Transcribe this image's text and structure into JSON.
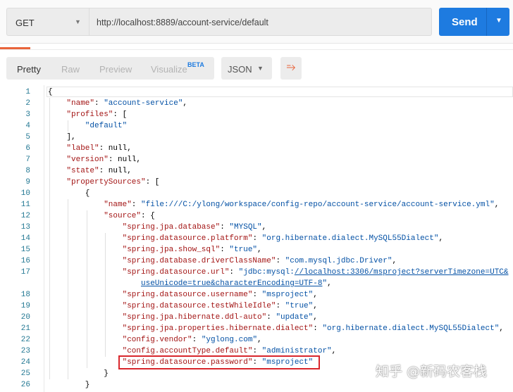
{
  "request": {
    "method": "GET",
    "url": "http://localhost:8889/account-service/default",
    "send_label": "Send"
  },
  "response_toolbar": {
    "views": [
      "Pretty",
      "Raw",
      "Preview",
      "Visualize"
    ],
    "beta_badge": "BETA",
    "format": "JSON",
    "wrap_icon": "wrap-lines-icon"
  },
  "colors": {
    "accent": "#1e7be0",
    "tab_indicator": "#e9643b",
    "key": "#a31515",
    "string": "#0451a5",
    "highlight_box": "#d9262c"
  },
  "code_lines": [
    {
      "n": "1",
      "i": 0,
      "t": [
        [
          "p",
          "{"
        ]
      ]
    },
    {
      "n": "2",
      "i": 1,
      "t": [
        [
          "k",
          "\"name\""
        ],
        [
          "p",
          ": "
        ],
        [
          "s",
          "\"account-service\""
        ],
        [
          "p",
          ","
        ]
      ]
    },
    {
      "n": "3",
      "i": 1,
      "t": [
        [
          "k",
          "\"profiles\""
        ],
        [
          "p",
          ": ["
        ]
      ]
    },
    {
      "n": "4",
      "i": 2,
      "t": [
        [
          "s",
          "\"default\""
        ]
      ]
    },
    {
      "n": "5",
      "i": 1,
      "t": [
        [
          "p",
          "],"
        ]
      ]
    },
    {
      "n": "6",
      "i": 1,
      "t": [
        [
          "k",
          "\"label\""
        ],
        [
          "p",
          ": null,"
        ]
      ]
    },
    {
      "n": "7",
      "i": 1,
      "t": [
        [
          "k",
          "\"version\""
        ],
        [
          "p",
          ": null,"
        ]
      ]
    },
    {
      "n": "8",
      "i": 1,
      "t": [
        [
          "k",
          "\"state\""
        ],
        [
          "p",
          ": null,"
        ]
      ]
    },
    {
      "n": "9",
      "i": 1,
      "t": [
        [
          "k",
          "\"propertySources\""
        ],
        [
          "p",
          ": ["
        ]
      ]
    },
    {
      "n": "10",
      "i": 2,
      "t": [
        [
          "p",
          "{"
        ]
      ]
    },
    {
      "n": "11",
      "i": 3,
      "t": [
        [
          "k",
          "\"name\""
        ],
        [
          "p",
          ": "
        ],
        [
          "s",
          "\"file:///C:/ylong/workspace/config-repo/account-service/account-service.yml\""
        ],
        [
          "p",
          ","
        ]
      ]
    },
    {
      "n": "12",
      "i": 3,
      "t": [
        [
          "k",
          "\"source\""
        ],
        [
          "p",
          ": {"
        ]
      ]
    },
    {
      "n": "13",
      "i": 4,
      "t": [
        [
          "k",
          "\"spring.jpa.database\""
        ],
        [
          "p",
          ": "
        ],
        [
          "s",
          "\"MYSQL\""
        ],
        [
          "p",
          ","
        ]
      ]
    },
    {
      "n": "14",
      "i": 4,
      "t": [
        [
          "k",
          "\"spring.datasource.platform\""
        ],
        [
          "p",
          ": "
        ],
        [
          "s",
          "\"org.hibernate.dialect.MySQL55Dialect\""
        ],
        [
          "p",
          ","
        ]
      ]
    },
    {
      "n": "15",
      "i": 4,
      "t": [
        [
          "k",
          "\"spring.jpa.show_sql\""
        ],
        [
          "p",
          ": "
        ],
        [
          "s",
          "\"true\""
        ],
        [
          "p",
          ","
        ]
      ]
    },
    {
      "n": "16",
      "i": 4,
      "t": [
        [
          "k",
          "\"spring.database.driverClassName\""
        ],
        [
          "p",
          ": "
        ],
        [
          "s",
          "\"com.mysql.jdbc.Driver\""
        ],
        [
          "p",
          ","
        ]
      ]
    },
    {
      "n": "17",
      "i": 4,
      "t": [
        [
          "k",
          "\"spring.datasource.url\""
        ],
        [
          "p",
          ": "
        ],
        [
          "s",
          "\"jdbc:mysql:"
        ],
        [
          "su",
          "//localhost:3306/msproject?serverTimezone=UTC&"
        ]
      ]
    },
    {
      "n": "",
      "i": 5,
      "t": [
        [
          "su",
          "useUnicode=true&characterEncoding=UTF-8"
        ],
        [
          "s",
          "\""
        ],
        [
          "p",
          ","
        ]
      ]
    },
    {
      "n": "18",
      "i": 4,
      "t": [
        [
          "k",
          "\"spring.datasource.username\""
        ],
        [
          "p",
          ": "
        ],
        [
          "s",
          "\"msproject\""
        ],
        [
          "p",
          ","
        ]
      ]
    },
    {
      "n": "19",
      "i": 4,
      "t": [
        [
          "k",
          "\"spring.datasource.testWhileIdle\""
        ],
        [
          "p",
          ": "
        ],
        [
          "s",
          "\"true\""
        ],
        [
          "p",
          ","
        ]
      ]
    },
    {
      "n": "20",
      "i": 4,
      "t": [
        [
          "k",
          "\"spring.jpa.hibernate.ddl-auto\""
        ],
        [
          "p",
          ": "
        ],
        [
          "s",
          "\"update\""
        ],
        [
          "p",
          ","
        ]
      ]
    },
    {
      "n": "21",
      "i": 4,
      "t": [
        [
          "k",
          "\"spring.jpa.properties.hibernate.dialect\""
        ],
        [
          "p",
          ": "
        ],
        [
          "s",
          "\"org.hibernate.dialect.MySQL55Dialect\""
        ],
        [
          "p",
          ","
        ]
      ]
    },
    {
      "n": "22",
      "i": 4,
      "t": [
        [
          "k",
          "\"config.vendor\""
        ],
        [
          "p",
          ": "
        ],
        [
          "s",
          "\"yglong.com\""
        ],
        [
          "p",
          ","
        ]
      ]
    },
    {
      "n": "23",
      "i": 4,
      "t": [
        [
          "k",
          "\"config.accountType.default\""
        ],
        [
          "p",
          ": "
        ],
        [
          "s",
          "\"administrator\""
        ],
        [
          "p",
          ","
        ]
      ]
    },
    {
      "n": "24",
      "i": 4,
      "t": [
        [
          "k",
          "\"spring.datasource.password\""
        ],
        [
          "p",
          ": "
        ],
        [
          "s",
          "\"msproject\""
        ]
      ]
    },
    {
      "n": "25",
      "i": 3,
      "t": [
        [
          "p",
          "}"
        ]
      ]
    },
    {
      "n": "26",
      "i": 2,
      "t": [
        [
          "p",
          "}"
        ]
      ]
    }
  ],
  "watermark": "知乎 @新码农客栈"
}
